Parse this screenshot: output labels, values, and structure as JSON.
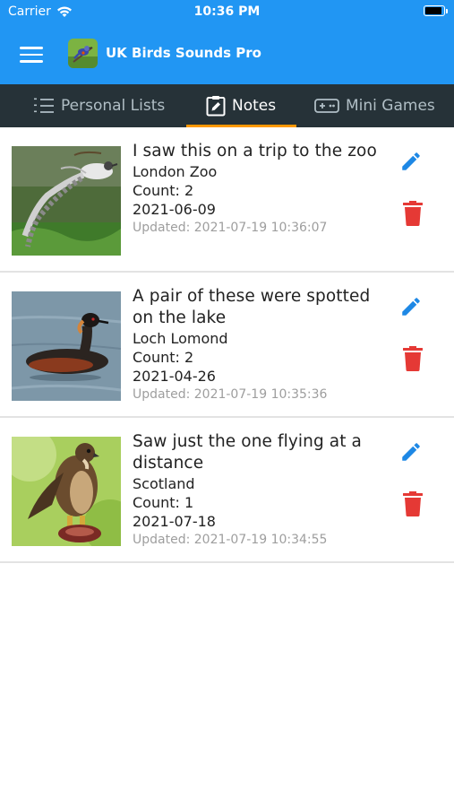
{
  "status_bar": {
    "carrier": "Carrier",
    "time": "10:36 PM",
    "battery_level": 0.95
  },
  "app_bar": {
    "title": "UK Birds Sounds Pro",
    "menu_icon": "hamburger-menu-icon"
  },
  "tabs": [
    {
      "label": "Personal Lists",
      "icon": "list-icon",
      "active": false
    },
    {
      "label": "Notes",
      "icon": "clipboard-edit-icon",
      "active": true
    },
    {
      "label": "Mini Games",
      "icon": "gamepad-icon",
      "active": false
    }
  ],
  "notes": [
    {
      "title": "I saw this on a trip to the zoo",
      "location": "London Zoo",
      "count": "Count: 2",
      "date": "2021-06-09",
      "updated": "Updated: 2021-07-19 10:36:07"
    },
    {
      "title": "A pair of these were spotted on the lake",
      "location": "Loch Lomond",
      "count": "Count: 2",
      "date": "2021-04-26",
      "updated": "Updated: 2021-07-19 10:35:36"
    },
    {
      "title": "Saw just the one flying at a distance",
      "location": "Scotland",
      "count": "Count: 1",
      "date": "2021-07-18",
      "updated": "Updated: 2021-07-19 10:34:55"
    }
  ],
  "colors": {
    "primary": "#2196f3",
    "tabbar": "#263238",
    "tab_indicator": "#ff9800",
    "edit": "#1e88e5",
    "delete": "#e53935"
  }
}
